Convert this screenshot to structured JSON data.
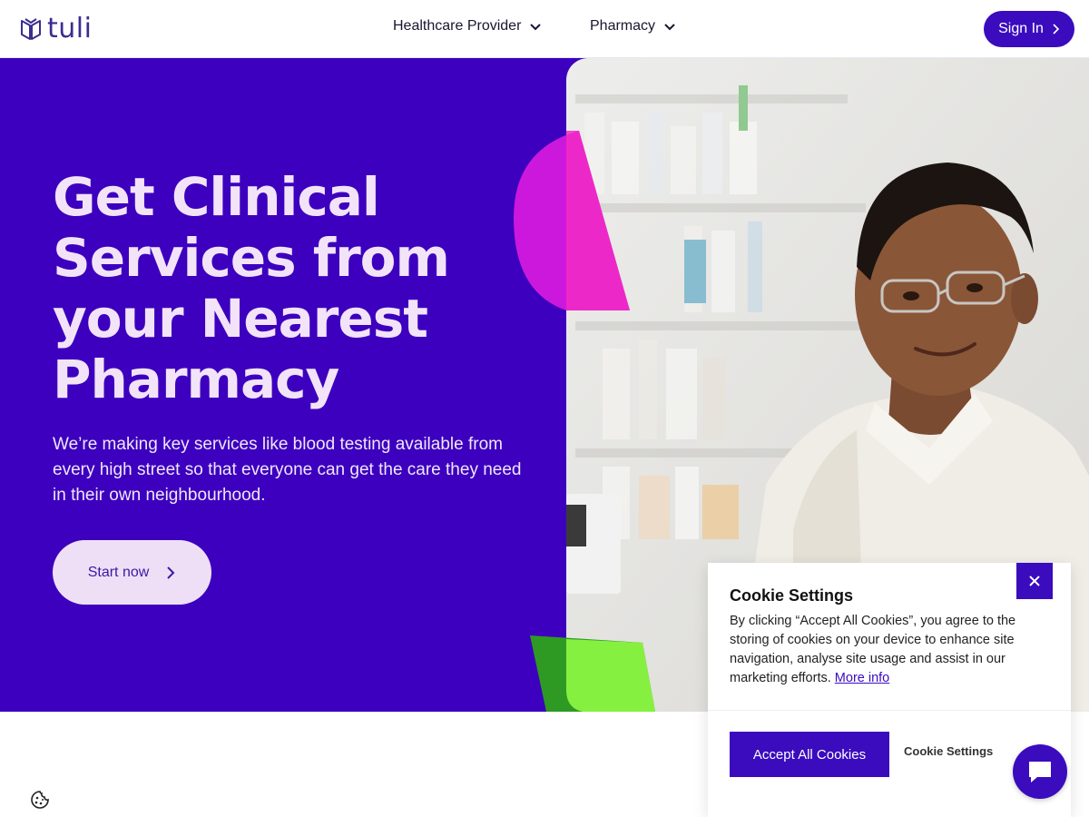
{
  "header": {
    "logo_text": "tuli",
    "nav": [
      {
        "label": "Healthcare Provider"
      },
      {
        "label": "Pharmacy"
      }
    ],
    "signin_label": "Sign In"
  },
  "hero": {
    "headline": "Get Clinical Services from your Nearest Pharmacy",
    "lead": "We’re making key services like blood testing available from every high street so that everyone can get the care they need in their own neighbourhood.",
    "cta_label": "Start now"
  },
  "cookie": {
    "title": "Cookie Settings",
    "text": "By clicking “Accept All Cookies”, you agree to the storing of cookies on your device to enhance site navigation, analyse site usage and assist in our marketing efforts.",
    "more_info_label": "More info",
    "accept_label": "Accept All Cookies",
    "settings_label": "Cookie Settings"
  },
  "colors": {
    "brand": "#3c00be",
    "hero_text": "#f2e3f8",
    "accent_magenta": "#e01ee0",
    "accent_green": "#7ee038"
  },
  "icons": {
    "chevron_down": "chevron-down-icon",
    "chevron_right": "chevron-right-icon",
    "close": "close-icon",
    "chat": "chat-icon",
    "cookie": "cookie-icon"
  }
}
